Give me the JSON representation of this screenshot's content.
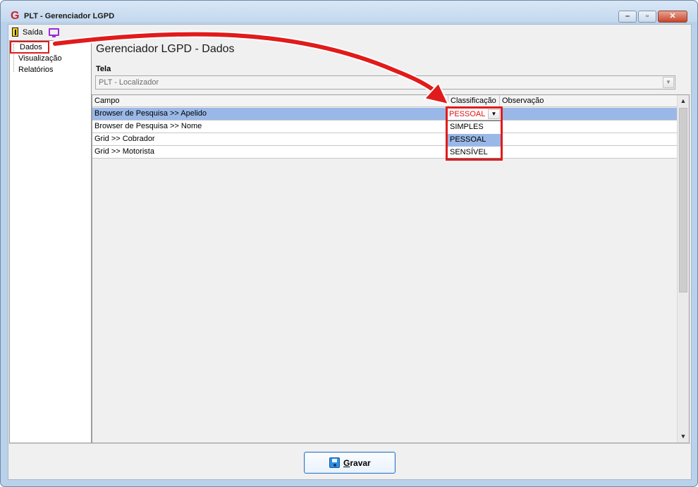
{
  "window": {
    "title": "PLT - Gerenciador LGPD"
  },
  "menu": {
    "exit_label": "Saída"
  },
  "nav": {
    "items": [
      "Dados",
      "Visualização",
      "Relatórios"
    ]
  },
  "main": {
    "title": "Gerenciador LGPD - Dados",
    "tela_label": "Tela",
    "tela_value": "PLT - Localizador"
  },
  "grid": {
    "columns": [
      "Campo",
      "Classificação",
      "Observação"
    ],
    "rows": [
      {
        "campo": "Browser de Pesquisa >> Apelido",
        "classificacao": "PESSOAL",
        "observacao": ""
      },
      {
        "campo": "Browser de Pesquisa >> Nome",
        "classificacao": "",
        "observacao": ""
      },
      {
        "campo": "Grid >> Cobrador",
        "classificacao": "",
        "observacao": ""
      },
      {
        "campo": "Grid >> Motorista",
        "classificacao": "",
        "observacao": ""
      }
    ],
    "selected_row": 0,
    "editor_value": "PESSOAL",
    "dropdown_options": [
      "SIMPLES",
      "PESSOAL",
      "SENSÍVEL"
    ],
    "dropdown_highlighted": "PESSOAL"
  },
  "footer": {
    "save_label": "Gravar"
  },
  "colors": {
    "highlight": "#9ab8e7",
    "annotation_red": "#e11b1b",
    "window_frame": "#b9d1ea"
  }
}
